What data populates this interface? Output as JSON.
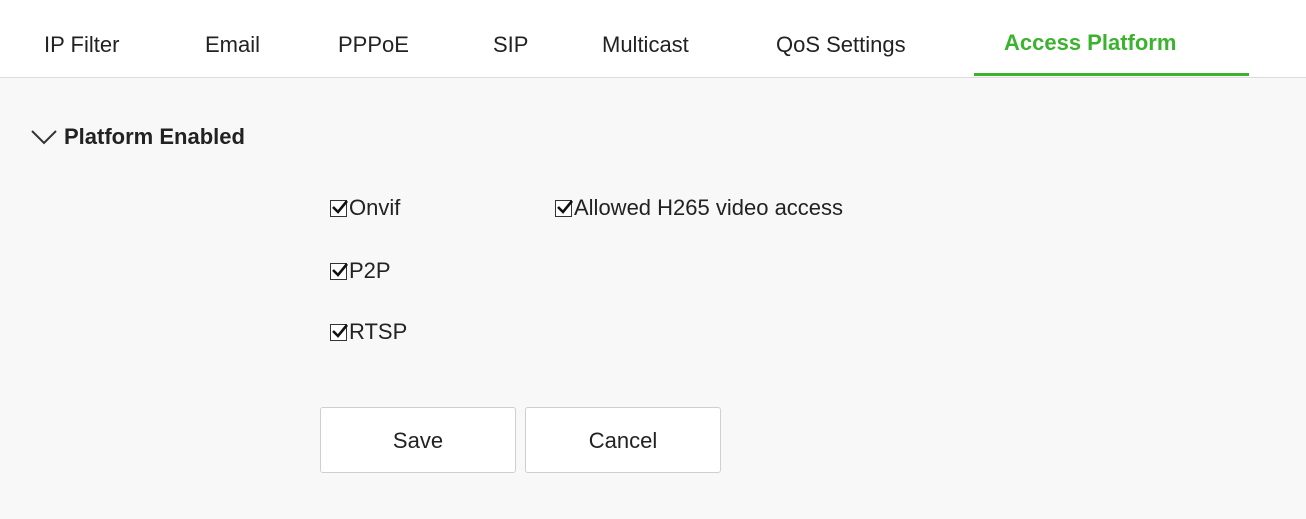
{
  "tabs": [
    {
      "label": "IP Filter",
      "active": false
    },
    {
      "label": "Email",
      "active": false
    },
    {
      "label": "PPPoE",
      "active": false
    },
    {
      "label": "SIP",
      "active": false
    },
    {
      "label": "Multicast",
      "active": false
    },
    {
      "label": "QoS Settings",
      "active": false
    },
    {
      "label": "Access Platform",
      "active": true
    }
  ],
  "section": {
    "title": "Platform Enabled",
    "expanded": true,
    "icon": "chevron-down-icon"
  },
  "options": [
    {
      "label": "Onvif",
      "checked": true
    },
    {
      "label": "Allowed H265 video access",
      "checked": true
    },
    {
      "label": "P2P",
      "checked": true
    },
    {
      "label": "RTSP",
      "checked": true
    }
  ],
  "buttons": {
    "save_label": "Save",
    "cancel_label": "Cancel"
  },
  "colors": {
    "accent": "#3cb32f",
    "text": "#222222",
    "panel_background": "#f8f8f8"
  }
}
